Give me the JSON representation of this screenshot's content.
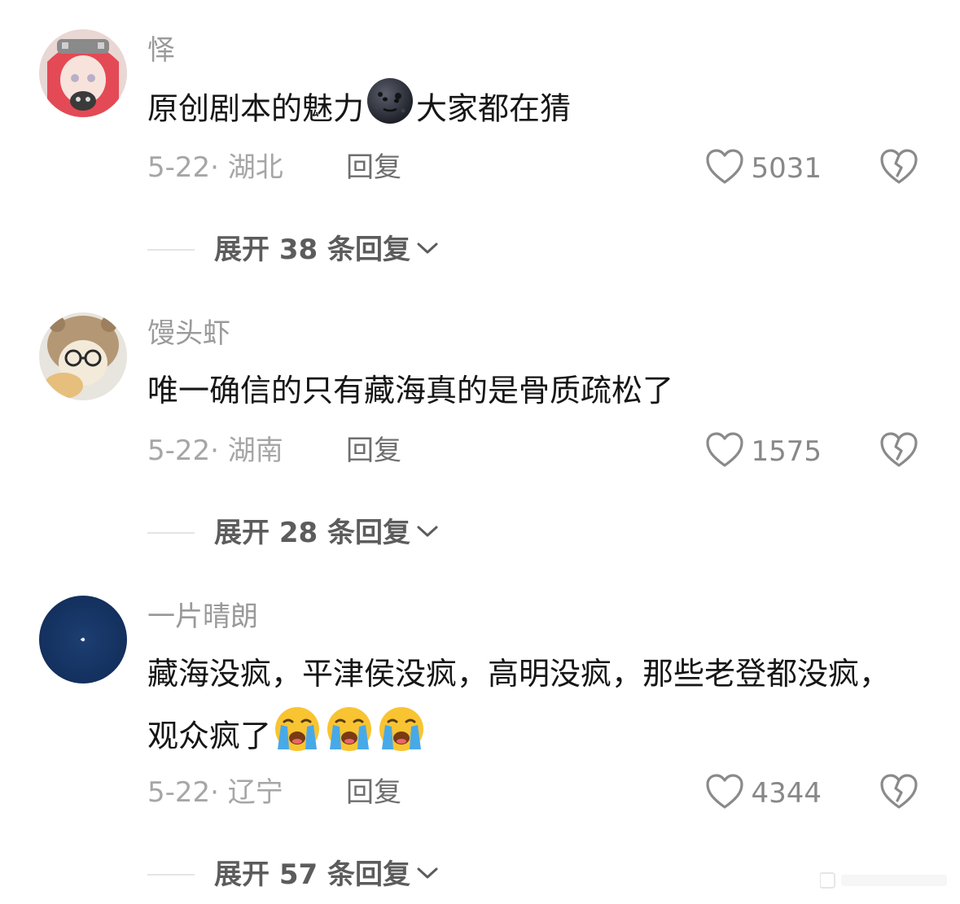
{
  "comments": [
    {
      "username": "怿",
      "text_before": "原创剧本的魅力",
      "text_after": "大家都在猜",
      "date": "5-22",
      "location": "湖北",
      "reply_label": "回复",
      "likes": "5031",
      "expand_label": "展开 38 条回复"
    },
    {
      "username": "馒头虾",
      "text": "唯一确信的只有藏海真的是骨质疏松了",
      "date": "5-22",
      "location": "湖南",
      "reply_label": "回复",
      "likes": "1575",
      "expand_label": "展开 28 条回复"
    },
    {
      "username": "一片晴朗",
      "text": "藏海没疯，平津侯没疯，高明没疯，那些老登都没疯，观众疯了",
      "date": "5-22",
      "location": "辽宁",
      "reply_label": "回复",
      "likes": "4344",
      "expand_label": "展开 57 条回复"
    }
  ],
  "colors": {
    "username": "#9a9a9a",
    "text": "#161616",
    "meta": "#a6a6a6",
    "reply": "#6e6e6e",
    "icon": "#8a8a8a"
  },
  "icons": {
    "like": "heart-outline-icon",
    "dislike": "broken-heart-icon",
    "expand": "chevron-down-icon",
    "emoji1": "new-moon-face-emoji",
    "emoji2": "loudly-crying-face-emoji"
  }
}
